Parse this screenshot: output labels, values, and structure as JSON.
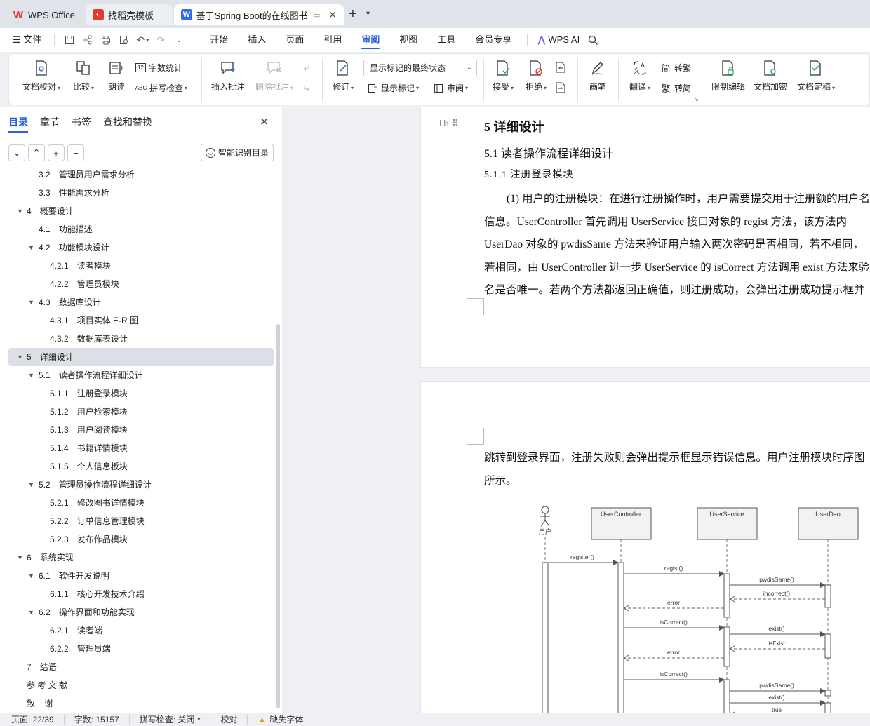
{
  "tabs": [
    {
      "label": "WPS Office",
      "icon": "wps-logo-icon"
    },
    {
      "label": "找稻壳模板",
      "icon": "daoke-icon"
    },
    {
      "label": "基于Spring Boot的在线图书",
      "icon": "writer-icon"
    }
  ],
  "menubar": {
    "file": "文件",
    "items": [
      "开始",
      "插入",
      "页面",
      "引用",
      "审阅",
      "视图",
      "工具",
      "会员专享"
    ],
    "active": "审阅",
    "ai": "WPS AI"
  },
  "ribbon": {
    "proofread": "文档校对",
    "compare": "比较",
    "read_aloud": "朗读",
    "word_count": "字数统计",
    "spell_check": "拼写检查",
    "insert_comment": "插入批注",
    "delete_comment": "删除批注",
    "revise": "修订",
    "markup_state": "显示标记的最终状态",
    "show_markup": "显示标记",
    "review": "审阅",
    "accept": "接受",
    "reject": "拒绝",
    "pen": "画笔",
    "translate": "翻译",
    "to_traditional": "转繁",
    "to_simplified": "转简",
    "restrict_edit": "限制编辑",
    "encrypt": "文档加密",
    "finalize": "文档定稿"
  },
  "sidebar": {
    "tabs": [
      "目录",
      "章节",
      "书签",
      "查找和替换"
    ],
    "smart_toc": "智能识别目录",
    "toc": [
      {
        "num": "3.2",
        "title": "管理员用户需求分析",
        "level": 2,
        "arrow": false
      },
      {
        "num": "3.3",
        "title": "性能需求分析",
        "level": 2,
        "arrow": false
      },
      {
        "num": "4",
        "title": "概要设计",
        "level": 1,
        "arrow": true
      },
      {
        "num": "4.1",
        "title": "功能描述",
        "level": 2,
        "arrow": false
      },
      {
        "num": "4.2",
        "title": "功能模块设计",
        "level": 2,
        "arrow": true
      },
      {
        "num": "4.2.1",
        "title": "读者模块",
        "level": 3,
        "arrow": false
      },
      {
        "num": "4.2.2",
        "title": "管理员模块",
        "level": 3,
        "arrow": false
      },
      {
        "num": "4.3",
        "title": "数据库设计",
        "level": 2,
        "arrow": true
      },
      {
        "num": "4.3.1",
        "title": "项目实体 E-R 图",
        "level": 3,
        "arrow": false
      },
      {
        "num": "4.3.2",
        "title": "数据库表设计",
        "level": 3,
        "arrow": false
      },
      {
        "num": "5",
        "title": "详细设计",
        "level": 1,
        "arrow": true,
        "selected": true
      },
      {
        "num": "5.1",
        "title": "读者操作流程详细设计",
        "level": 2,
        "arrow": true
      },
      {
        "num": "5.1.1",
        "title": "注册登录模块",
        "level": 3,
        "arrow": false
      },
      {
        "num": "5.1.2",
        "title": "用户检索模块",
        "level": 3,
        "arrow": false
      },
      {
        "num": "5.1.3",
        "title": "用户阅读模块",
        "level": 3,
        "arrow": false
      },
      {
        "num": "5.1.4",
        "title": "书籍详情模块",
        "level": 3,
        "arrow": false
      },
      {
        "num": "5.1.5",
        "title": "个人信息板块",
        "level": 3,
        "arrow": false
      },
      {
        "num": "5.2",
        "title": "管理员操作流程详细设计",
        "level": 2,
        "arrow": true
      },
      {
        "num": "5.2.1",
        "title": "修改图书详情模块",
        "level": 3,
        "arrow": false
      },
      {
        "num": "5.2.2",
        "title": "订单信息管理模块",
        "level": 3,
        "arrow": false
      },
      {
        "num": "5.2.3",
        "title": "发布作品模块",
        "level": 3,
        "arrow": false
      },
      {
        "num": "6",
        "title": "系统实现",
        "level": 1,
        "arrow": true
      },
      {
        "num": "6.1",
        "title": "软件开发说明",
        "level": 2,
        "arrow": true
      },
      {
        "num": "6.1.1",
        "title": "核心开发技术介绍",
        "level": 3,
        "arrow": false
      },
      {
        "num": "6.2",
        "title": "操作界面和功能实现",
        "level": 2,
        "arrow": true
      },
      {
        "num": "6.2.1",
        "title": "读者端",
        "level": 3,
        "arrow": false
      },
      {
        "num": "6.2.2",
        "title": "管理员端",
        "level": 3,
        "arrow": false
      },
      {
        "num": "7",
        "title": "结语",
        "level": 1,
        "arrow": false
      },
      {
        "num": "",
        "title": "参 考 文 献",
        "level": 1,
        "arrow": false
      },
      {
        "num": "",
        "title": "致    谢",
        "level": 1,
        "arrow": false
      }
    ]
  },
  "document": {
    "heading1": "5   详细设计",
    "heading2": "5.1   读者操作流程详细设计",
    "heading3": "5.1.1   注册登录模块",
    "para1_lines": [
      "(1) 用户的注册模块：在进行注册操作时，用户需要提交用于注册额的用户名",
      "信息。UserController 首先调用 UserService 接口对象的 regist 方法，该方法内",
      "UserDao 对象的 pwdisSame 方法来验证用户输入两次密码是否相同，若不相同，",
      "若相同，由 UserController 进一步 UserService 的 isCorrect 方法调用 exist 方法来验",
      "名是否唯一。若两个方法都返回正确值，则注册成功，会弹出注册成功提示框并"
    ],
    "para2_lines": [
      "跳转到登录界面，注册失败则会弹出提示框显示错误信息。用户注册模块时序图",
      "所示。"
    ],
    "diagram": {
      "actors": [
        "用户",
        "UserController",
        "UserService",
        "UserDao"
      ],
      "messages": [
        "register()",
        "regist()",
        "pwdisSame()",
        "incorrect()",
        "error",
        "isCorrect()",
        "exist()",
        "isExist",
        "error",
        "isCorrect()",
        "pwdisSame()",
        "exist()",
        "true"
      ]
    }
  },
  "status": {
    "page": "页面: 22/39",
    "words": "字数: 15157",
    "spell": "拼写检查: 关闭",
    "proof": "校对",
    "missing_font": "缺失字体"
  },
  "colors": {
    "accent": "#2a62d8",
    "wps_red": "#e23b2e",
    "writer_blue": "#2f6bf0"
  }
}
